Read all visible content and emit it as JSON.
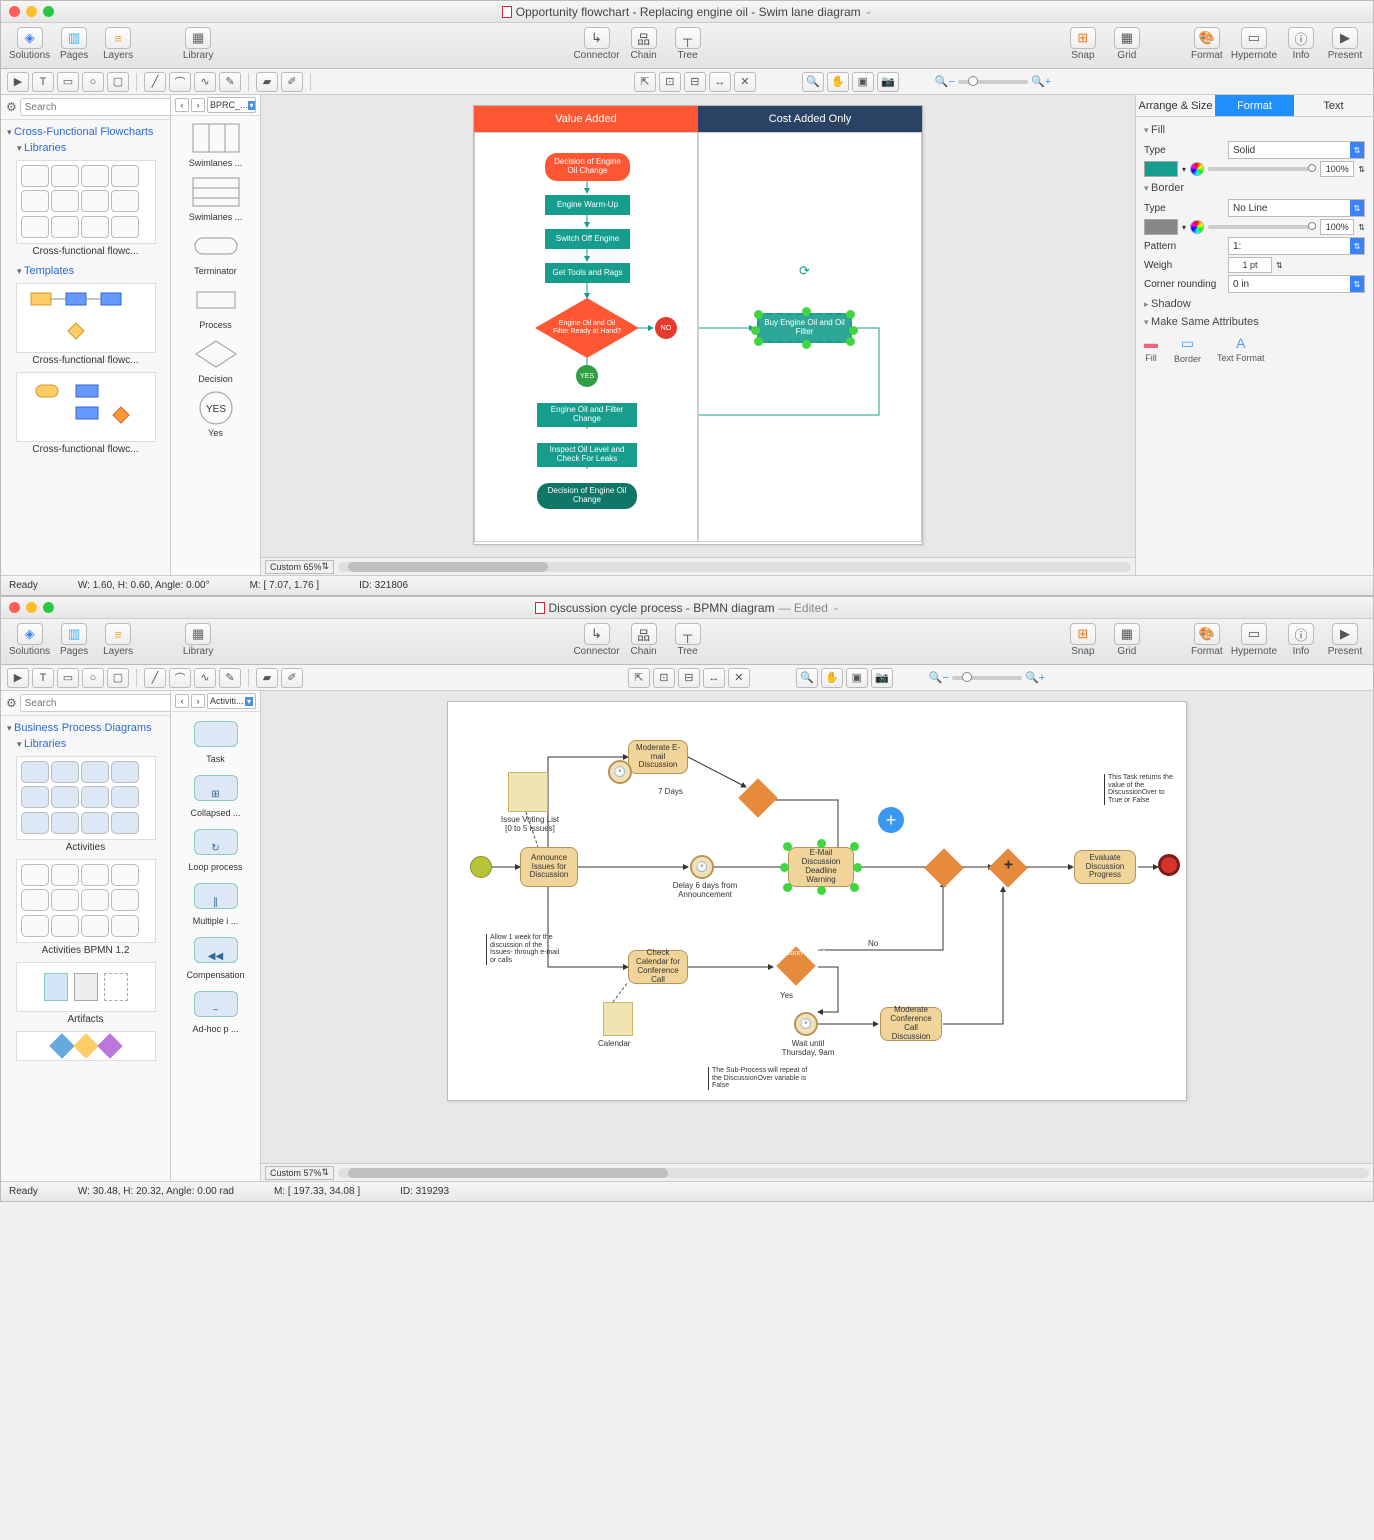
{
  "window1": {
    "title": "Opportunity flowchart - Replacing engine oil - Swim lane diagram",
    "toolbar": {
      "solutions": "Solutions",
      "pages": "Pages",
      "layers": "Layers",
      "library": "Library",
      "connector": "Connector",
      "chain": "Chain",
      "tree": "Tree",
      "snap": "Snap",
      "grid": "Grid",
      "format": "Format",
      "hypernote": "Hypernote",
      "info": "Info",
      "present": "Present"
    },
    "left": {
      "search_placeholder": "Search",
      "section": "Cross-Functional Flowcharts",
      "libs": "Libraries",
      "tmpls": "Templates",
      "item1": "Cross-functional flowc...",
      "item2": "Cross-functional flowc...",
      "item3": "Cross-functional flowc..."
    },
    "shapes": {
      "dropdown": "BPRC_...",
      "s1": "Swimlanes  ...",
      "s2": "Swimlanes  ...",
      "s3": "Terminator",
      "s4": "Process",
      "s5": "Decision",
      "s6": "Yes"
    },
    "swim": {
      "h1": "Value Added",
      "h2": "Cost Added Only",
      "n1": "Decision of Engine Oil Change",
      "n2": "Engine Warm-Up",
      "n3": "Switch Off Engine",
      "n4": "Get Tools and Rags",
      "n5": "Engine Oil and Oil Filter Ready at Hand?",
      "no": "NO",
      "yes": "YES",
      "n6": "Buy Engine Oil and Oil Filter",
      "n7": "Engine Oil and Filter Change",
      "n8": "Inspect Oil Level and Check For Leaks",
      "n9": "Decision of Engine Oil Change"
    },
    "canvas_footer": {
      "zoom": "Custom 65%"
    },
    "right": {
      "tabs": {
        "arrange": "Arrange & Size",
        "format": "Format",
        "text": "Text"
      },
      "fill": "Fill",
      "type_lbl": "Type",
      "type_val": "Solid",
      "opacity": "100%",
      "border": "Border",
      "border_type": "No Line",
      "border_opacity": "100%",
      "pattern": "Pattern",
      "pattern_val": "1:",
      "weigh": "Weigh",
      "weigh_val": "1 pt",
      "corner": "Corner rounding",
      "corner_val": "0 in",
      "shadow": "Shadow",
      "same": "Make Same Attributes",
      "attr_fill": "Fill",
      "attr_border": "Border",
      "attr_text": "Text Format"
    },
    "status": {
      "ready": "Ready",
      "wh": "W: 1.60,  H: 0.60,  Angle: 0.00°",
      "m": "M: [ 7.07, 1.76 ]",
      "id": "ID: 321806"
    }
  },
  "window2": {
    "title": "Discussion cycle process - BPMN diagram",
    "edited": "— Edited",
    "toolbar": {
      "solutions": "Solutions",
      "pages": "Pages",
      "layers": "Layers",
      "library": "Library",
      "connector": "Connector",
      "chain": "Chain",
      "tree": "Tree",
      "snap": "Snap",
      "grid": "Grid",
      "format": "Format",
      "hypernote": "Hypernote",
      "info": "Info",
      "present": "Present"
    },
    "left": {
      "search_placeholder": "Search",
      "section": "Business Process Diagrams",
      "libs": "Libraries",
      "item1": "Activities",
      "item2": "Activities BPMN 1.2",
      "item3": "Artifacts"
    },
    "shapes": {
      "dropdown": "Activiti...",
      "s1": "Task",
      "s2": "Collapsed  ...",
      "s3": "Loop process",
      "s4": "Multiple i ...",
      "s5": "Compensation",
      "s6": "Ad-hoc p ..."
    },
    "bpmn": {
      "n1": "Announce Issues for Discussion",
      "n2": "Moderate E-mail Discussion",
      "n3": "E-Mail Discussion Deadline Warning",
      "n4": "Check Calendar for Conference Call",
      "n5": "Conference Call in Discussion Week?",
      "n6": "Moderate Conference Call Discussion",
      "n7": "Evaluate Discussion Progress",
      "issue": "Issue Voting List [0 to 5 Issues]",
      "calendar": "Calendar",
      "days7": "7 Days",
      "delay": "Delay 6 days from Announcement",
      "wait": "Wait until Thursday, 9am",
      "yes": "Yes",
      "no": "No",
      "allow": "Allow 1 week for the discussion of the Issues- through e-mail or calls",
      "sub": "The Sub-Process will repeat of the DiscussionOver variable is False",
      "ret": "This Task returns the value of the DiscussionOver to True or False"
    },
    "canvas_footer": {
      "zoom": "Custom 57%"
    },
    "status": {
      "ready": "Ready",
      "wh": "W: 30.48,  H: 20.32,  Angle: 0.00 rad",
      "m": "M: [ 197.33, 34.08 ]",
      "id": "ID: 319293"
    }
  }
}
